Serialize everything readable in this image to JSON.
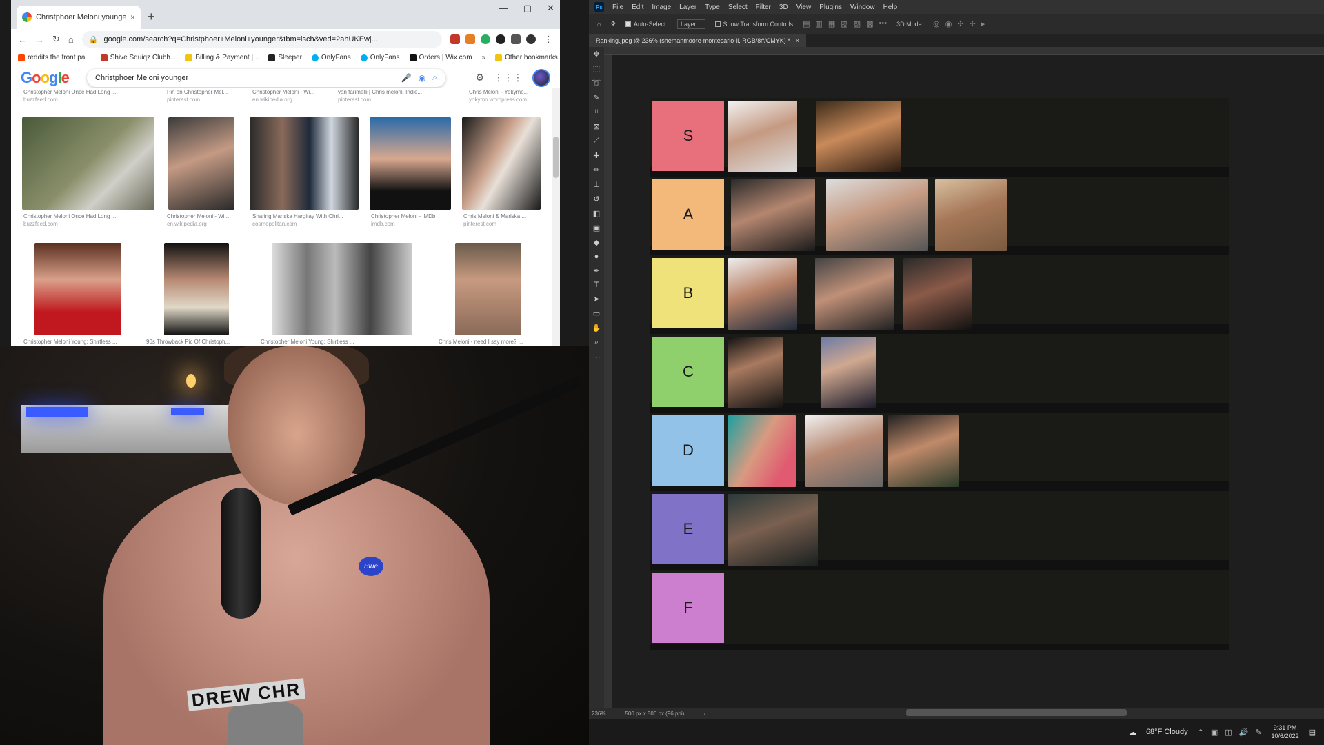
{
  "chrome": {
    "tab_title": "Christphoer Meloni younger - Go",
    "tab_close": "×",
    "new_tab": "+",
    "win_min": "—",
    "win_max": "▢",
    "win_close": "✕",
    "url": "google.com/search?q=Christphoer+Meloni+younger&tbm=isch&ved=2ahUKEwj...",
    "bookmarks": [
      "reddits the front pa...",
      "Shive Squiqz Clubh...",
      "Billing & Payment |...",
      "Sleeper",
      "OnlyFans",
      "OnlyFans",
      "Orders | Wix.com",
      "»",
      "Other bookmarks"
    ],
    "search_query": "Christphoer Meloni younger",
    "top_captions": [
      {
        "t": "Christopher Meloni Once Had Long ...",
        "s": "buzzfeed.com"
      },
      {
        "t": "Pin on Christopher Mel...",
        "s": "pinterest.com"
      },
      {
        "t": "Christopher Meloni - Wi...",
        "s": "en.wikipedia.org"
      },
      {
        "t": "van farimelli | Chris meloni, Indie...",
        "s": "pinterest.com"
      },
      {
        "t": "Chris Meloni - Yokymo...",
        "s": "yokymo.wordpress.com"
      }
    ],
    "row1_captions": [
      {
        "t": "Christopher Meloni Once Had Long ...",
        "s": "buzzfeed.com"
      },
      {
        "t": "Christopher Meloni - Wi...",
        "s": "en.wikipedia.org"
      },
      {
        "t": "Sharing Mariska Hargitay With Chri...",
        "s": "cosmopolitan.com"
      },
      {
        "t": "Christopher Meloni - IMDb",
        "s": "imdb.com"
      },
      {
        "t": "Chris Meloni & Mariska ...",
        "s": "pinterest.com"
      }
    ],
    "row2_captions": [
      {
        "t": "Christopher Meloni Young: Shirtless ...",
        "s": ""
      },
      {
        "t": "90s Throwback Pic Of Christoph...",
        "s": ""
      },
      {
        "t": "Christopher Meloni Young: Shirtless ...",
        "s": ""
      },
      {
        "t": "Chris Meloni - need I say more? ...",
        "s": ""
      }
    ]
  },
  "cam": {
    "badge": "Blue",
    "waistband": "DREW CHR"
  },
  "photoshop": {
    "menu": [
      "File",
      "Edit",
      "Image",
      "Layer",
      "Type",
      "Select",
      "Filter",
      "3D",
      "View",
      "Plugins",
      "Window",
      "Help"
    ],
    "options": {
      "auto_select": "Auto-Select:",
      "layer_dropdown": "Layer",
      "transform": "Show Transform Controls",
      "mode_3d": "3D Mode:"
    },
    "doc_tab": "Ranking.jpeg @ 236% (shemanmoore-montecarlo-ll, RGB/8#/CMYK) *",
    "doc_tab_close": "×",
    "status_zoom": "236%",
    "status_size": "500 px x 500 px (96 ppi)",
    "status_arrow": "›",
    "weather": "68°F  Cloudy",
    "time": "9:31 PM",
    "date": "10/6/2022"
  },
  "tiers": [
    {
      "label": "S",
      "color": "#e8707c"
    },
    {
      "label": "A",
      "color": "#f2b97a"
    },
    {
      "label": "B",
      "color": "#f0e27a"
    },
    {
      "label": "C",
      "color": "#8fd06c"
    },
    {
      "label": "D",
      "color": "#93c2e8"
    },
    {
      "label": "E",
      "color": "#7f72c7"
    },
    {
      "label": "F",
      "color": "#cd7fcf"
    }
  ]
}
